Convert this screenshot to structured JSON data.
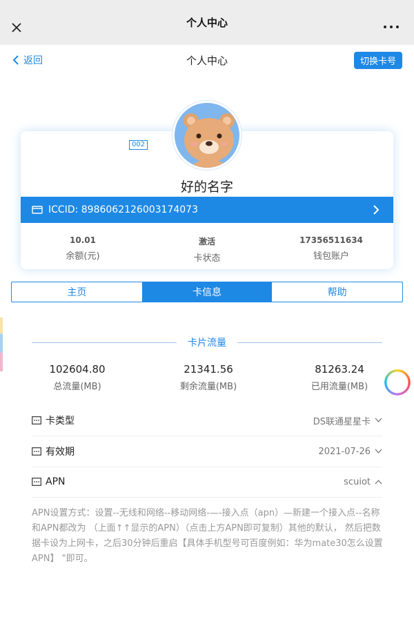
{
  "topbar": {
    "title": "个人中心"
  },
  "navbar": {
    "back_label": "返回",
    "title": "个人中心",
    "switch_label": "切换卡号"
  },
  "profile": {
    "id_badge": "002",
    "name": "好的名字",
    "iccid": "ICCID: 8986062126003174073",
    "stats": [
      {
        "value": "10.01",
        "label": "余额(元)"
      },
      {
        "value": "激活",
        "label": "卡状态"
      },
      {
        "value": "17356511634",
        "label": "钱包账户"
      }
    ]
  },
  "tabs": [
    {
      "label": "主页"
    },
    {
      "label": "卡信息"
    },
    {
      "label": "帮助"
    }
  ],
  "section": {
    "title": "卡片流量"
  },
  "flow": [
    {
      "value": "102604.80",
      "label": "总流量(MB)"
    },
    {
      "value": "21341.56",
      "label": "剩余流量(MB)"
    },
    {
      "value": "81263.24",
      "label": "已用流量(MB)"
    }
  ],
  "details": {
    "card_type": {
      "label": "卡类型",
      "value": "DS联通星星卡"
    },
    "validity": {
      "label": "有效期",
      "value": "2021-07-26"
    },
    "apn": {
      "label": "APN",
      "value": "scuiot"
    }
  },
  "apn_help": "APN设置方式：设置--无线和网络--移动网络-—-接入点（apn）—新建一个接入点--名称和APN都改为 （上面↑↑显示的APN）（点击上方APN即可复制）其他的默认， 然后把数据卡设为上网卡，之后30分钟后重启【具体手机型号可百度例如：华为mate30怎么设置APN】 \"即可。",
  "colors": {
    "accent": "#1e88e5"
  }
}
